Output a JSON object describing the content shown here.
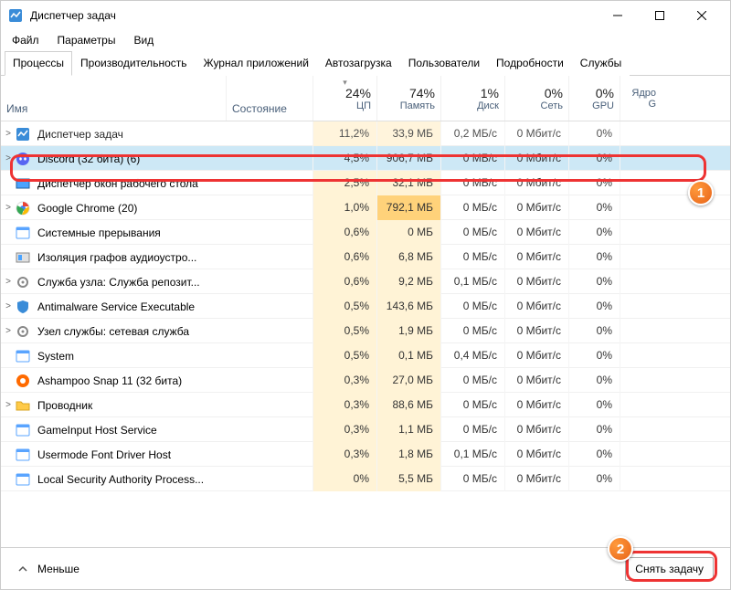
{
  "window": {
    "title": "Диспетчер задач"
  },
  "menu": {
    "file": "Файл",
    "options": "Параметры",
    "view": "Вид"
  },
  "tabs": [
    "Процессы",
    "Производительность",
    "Журнал приложений",
    "Автозагрузка",
    "Пользователи",
    "Подробности",
    "Службы"
  ],
  "columns": {
    "name": "Имя",
    "state": "Состояние",
    "cpu": {
      "pct": "24%",
      "label": "ЦП"
    },
    "mem": {
      "pct": "74%",
      "label": "Память"
    },
    "disk": {
      "pct": "1%",
      "label": "Диск"
    },
    "net": {
      "pct": "0%",
      "label": "Сеть"
    },
    "gpu": {
      "pct": "0%",
      "label": "GPU"
    },
    "gpucore": "Ядро G"
  },
  "rows": [
    {
      "exp": ">",
      "icon": "chart",
      "name": "Диспетчер задач",
      "cpu": "11,2%",
      "mem": "33,9 МБ",
      "disk": "0,2 МБ/с",
      "net": "0 Мбит/с",
      "gpu": "0%",
      "cut": true
    },
    {
      "exp": ">",
      "icon": "discord",
      "name": "Discord (32 бита) (6)",
      "cpu": "4,5%",
      "mem": "906,7 МБ",
      "disk": "0 МБ/с",
      "net": "0 Мбит/с",
      "gpu": "0%",
      "sel": true
    },
    {
      "exp": "",
      "icon": "dwm",
      "name": "Диспетчер окон рабочего стола",
      "cpu": "2,5%",
      "mem": "32,1 МБ",
      "disk": "0 МБ/с",
      "net": "0 Мбит/с",
      "gpu": "0%"
    },
    {
      "exp": ">",
      "icon": "chrome",
      "name": "Google Chrome (20)",
      "cpu": "1,0%",
      "mem": "792,1 МБ",
      "disk": "0 МБ/с",
      "net": "0 Мбит/с",
      "gpu": "0%",
      "memhi": true
    },
    {
      "exp": "",
      "icon": "sys",
      "name": "Системные прерывания",
      "cpu": "0,6%",
      "mem": "0 МБ",
      "disk": "0 МБ/с",
      "net": "0 Мбит/с",
      "gpu": "0%"
    },
    {
      "exp": "",
      "icon": "audio",
      "name": "Изоляция графов аудиоустро...",
      "cpu": "0,6%",
      "mem": "6,8 МБ",
      "disk": "0 МБ/с",
      "net": "0 Мбит/с",
      "gpu": "0%"
    },
    {
      "exp": ">",
      "icon": "svc",
      "name": "Служба узла: Служба репозит...",
      "cpu": "0,6%",
      "mem": "9,2 МБ",
      "disk": "0,1 МБ/с",
      "net": "0 Мбит/с",
      "gpu": "0%"
    },
    {
      "exp": ">",
      "icon": "shield",
      "name": "Antimalware Service Executable",
      "cpu": "0,5%",
      "mem": "143,6 МБ",
      "disk": "0 МБ/с",
      "net": "0 Мбит/с",
      "gpu": "0%"
    },
    {
      "exp": ">",
      "icon": "svc",
      "name": "Узел службы: сетевая служба",
      "cpu": "0,5%",
      "mem": "1,9 МБ",
      "disk": "0 МБ/с",
      "net": "0 Мбит/с",
      "gpu": "0%"
    },
    {
      "exp": "",
      "icon": "sys",
      "name": "System",
      "cpu": "0,5%",
      "mem": "0,1 МБ",
      "disk": "0,4 МБ/с",
      "net": "0 Мбит/с",
      "gpu": "0%"
    },
    {
      "exp": "",
      "icon": "snap",
      "name": "Ashampoo Snap 11 (32 бита)",
      "cpu": "0,3%",
      "mem": "27,0 МБ",
      "disk": "0 МБ/с",
      "net": "0 Мбит/с",
      "gpu": "0%"
    },
    {
      "exp": ">",
      "icon": "folder",
      "name": "Проводник",
      "cpu": "0,3%",
      "mem": "88,6 МБ",
      "disk": "0 МБ/с",
      "net": "0 Мбит/с",
      "gpu": "0%"
    },
    {
      "exp": "",
      "icon": "app",
      "name": "GameInput Host Service",
      "cpu": "0,3%",
      "mem": "1,1 МБ",
      "disk": "0 МБ/с",
      "net": "0 Мбит/с",
      "gpu": "0%"
    },
    {
      "exp": "",
      "icon": "app",
      "name": "Usermode Font Driver Host",
      "cpu": "0,3%",
      "mem": "1,8 МБ",
      "disk": "0,1 МБ/с",
      "net": "0 Мбит/с",
      "gpu": "0%"
    },
    {
      "exp": "",
      "icon": "app",
      "name": "Local Security Authority Process...",
      "cpu": "0%",
      "mem": "5,5 МБ",
      "disk": "0 МБ/с",
      "net": "0 Мбит/с",
      "gpu": "0%"
    }
  ],
  "footer": {
    "fewer": "Меньше",
    "end": "Снять задачу"
  },
  "badges": {
    "b1": "1",
    "b2": "2"
  }
}
